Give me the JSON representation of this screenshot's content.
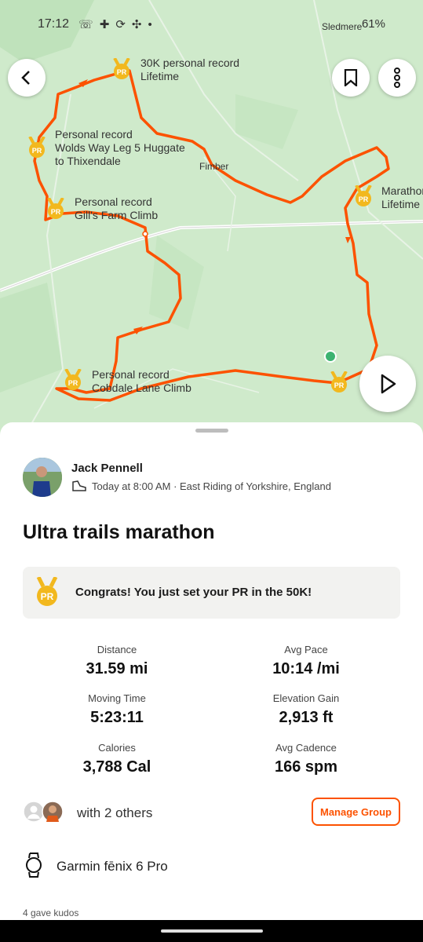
{
  "status": {
    "time": "17:12",
    "battery": "61%"
  },
  "map": {
    "place_labels": {
      "fimber": "Fimber",
      "sledmere": "Sledmere"
    },
    "pr_labels": [
      {
        "title": "30K personal record",
        "subtitle": "Lifetime"
      },
      {
        "title": "Personal record",
        "subtitle": "Wolds Way Leg 5 Huggate",
        "subtitle2": "to Thixendale"
      },
      {
        "title": "Personal record",
        "subtitle": "Gill's Farm Climb"
      },
      {
        "title": "Marathon",
        "subtitle": "Lifetime"
      },
      {
        "title": "Personal record",
        "subtitle": "Cobdale Lane Climb"
      }
    ],
    "route_color": "#fc5200",
    "map_color": "#cfeacb"
  },
  "activity": {
    "athlete_name": "Jack Pennell",
    "meta": "Today at 8:00 AM · East Riding of Yorkshire, England",
    "title": "Ultra trails marathon",
    "congrats": "Congrats! You just set your PR in the 50K!",
    "pr_badge_text": "PR",
    "stats": [
      {
        "label": "Distance",
        "value": "31.59 mi"
      },
      {
        "label": "Avg Pace",
        "value": "10:14 /mi"
      },
      {
        "label": "Moving Time",
        "value": "5:23:11"
      },
      {
        "label": "Elevation Gain",
        "value": "2,913 ft"
      },
      {
        "label": "Calories",
        "value": "3,788 Cal"
      },
      {
        "label": "Avg Cadence",
        "value": "166 spm"
      }
    ],
    "group_text": "with 2 others",
    "manage_group": "Manage Group",
    "device": "Garmin fēnix 6 Pro",
    "kudos": "4 gave kudos"
  },
  "colors": {
    "accent": "#fc5200",
    "badge": "#f2b81e"
  }
}
